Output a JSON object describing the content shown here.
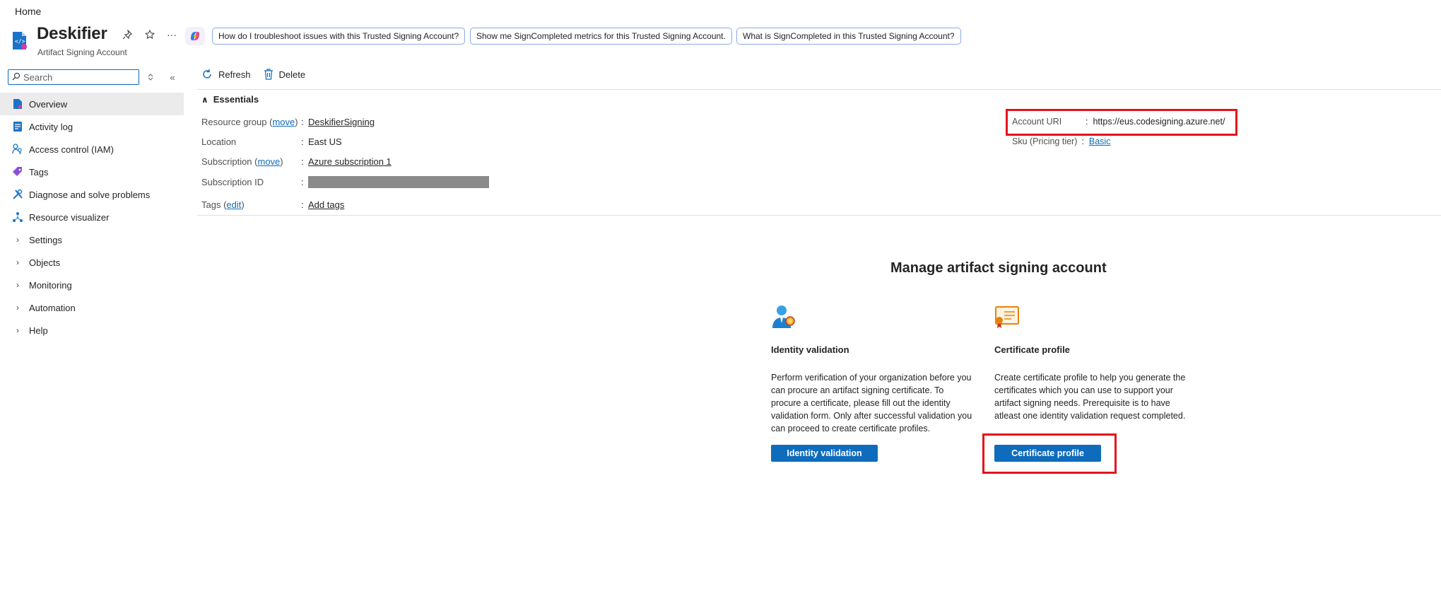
{
  "breadcrumb": {
    "home": "Home"
  },
  "header": {
    "title": "Deskifier",
    "subtitle": "Artifact Signing Account",
    "actions": [
      "pin-icon",
      "star-icon",
      "more-icon"
    ],
    "suggestions": [
      "How do I troubleshoot issues with this Trusted Signing Account?",
      "Show me SignCompleted metrics for this Trusted Signing Account.",
      "What is SignCompleted in this Trusted Signing Account?"
    ]
  },
  "sidebar": {
    "search_placeholder": "Search",
    "items": [
      {
        "label": "Overview",
        "icon": "overview-icon",
        "active": true
      },
      {
        "label": "Activity log",
        "icon": "activity-log-icon"
      },
      {
        "label": "Access control (IAM)",
        "icon": "iam-icon"
      },
      {
        "label": "Tags",
        "icon": "tag-icon"
      },
      {
        "label": "Diagnose and solve problems",
        "icon": "wrench-icon"
      },
      {
        "label": "Resource visualizer",
        "icon": "visualizer-icon"
      },
      {
        "label": "Settings",
        "expandable": true
      },
      {
        "label": "Objects",
        "expandable": true
      },
      {
        "label": "Monitoring",
        "expandable": true
      },
      {
        "label": "Automation",
        "expandable": true
      },
      {
        "label": "Help",
        "expandable": true
      }
    ]
  },
  "toolbar": {
    "refresh": "Refresh",
    "delete": "Delete"
  },
  "essentials": {
    "heading": "Essentials",
    "rows": {
      "resource_group": {
        "label": "Resource group",
        "move": "move",
        "value": "DeskifierSigning"
      },
      "location": {
        "label": "Location",
        "value": "East US"
      },
      "subscription": {
        "label": "Subscription",
        "move": "move",
        "value": "Azure subscription 1"
      },
      "subscription_id": {
        "label": "Subscription ID",
        "value": ""
      },
      "tags": {
        "label": "Tags",
        "edit": "edit",
        "value": "Add tags"
      }
    },
    "right": {
      "account_uri": {
        "label": "Account URI",
        "value": "https://eus.codesigning.azure.net/"
      },
      "sku": {
        "label": "Sku (Pricing tier)",
        "value": "Basic"
      }
    }
  },
  "manage": {
    "title": "Manage artifact signing account",
    "identity": {
      "title": "Identity validation",
      "description": "Perform verification of your organization before you can procure an artifact signing certificate. To procure a certificate, please fill out the identity validation form. Only after successful validation you can proceed to create certificate profiles.",
      "button": "Identity validation"
    },
    "certificate": {
      "title": "Certificate profile",
      "description": "Create certificate profile to help you generate the certificates which you can use to support your artifact signing needs. Prerequisite is to have atleast one identity validation request completed.",
      "button": "Certificate profile"
    }
  },
  "colors": {
    "accent": "#0f6cbd",
    "highlight": "#e3141c",
    "active_nav": "#ebebeb"
  }
}
